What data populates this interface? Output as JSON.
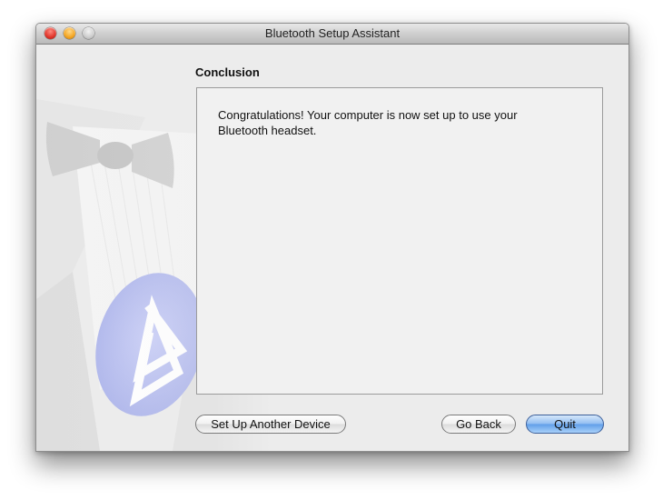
{
  "window": {
    "title": "Bluetooth Setup Assistant",
    "controls": [
      "close",
      "minimize",
      "zoom"
    ]
  },
  "art": {
    "icon": "bluetooth-icon",
    "accent": "#b8bff0"
  },
  "section": {
    "title": "Conclusion"
  },
  "content": {
    "message_line1": "Congratulations! Your computer is now set up to use your",
    "message_line2": "Bluetooth headset."
  },
  "buttons": {
    "setup_another": "Set Up Another Device",
    "go_back": "Go Back",
    "quit": "Quit"
  },
  "colors": {
    "window_bg": "#ececec",
    "default_button": "#5f9ee8",
    "close": "#e0352b",
    "minimize": "#f3a523",
    "zoom": "#cdcdcd"
  }
}
